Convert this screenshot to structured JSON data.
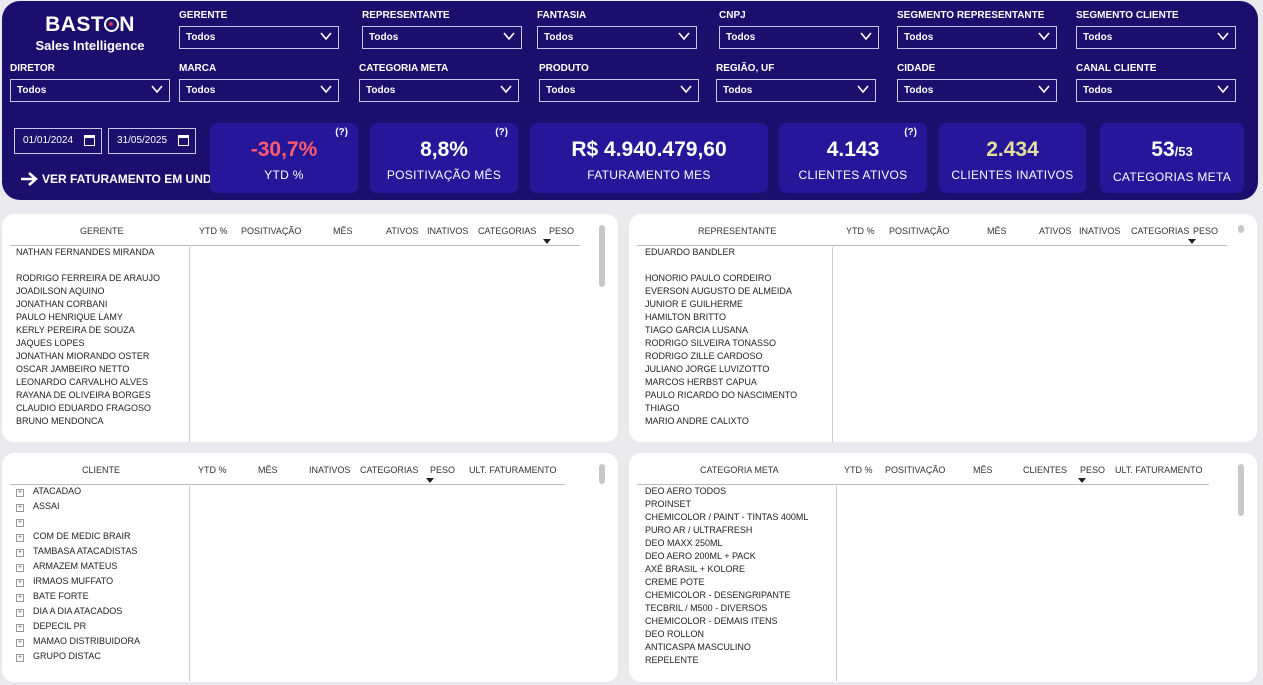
{
  "logo": {
    "brand_left": "BAST",
    "brand_right": "N",
    "subtitle": "Sales Intelligence"
  },
  "filters": [
    {
      "label": "GERENTE",
      "value": "Todos"
    },
    {
      "label": "REPRESENTANTE",
      "value": "Todos"
    },
    {
      "label": "FANTASIA",
      "value": "Todos"
    },
    {
      "label": "CNPJ",
      "value": "Todos"
    },
    {
      "label": "SEGMENTO REPRESENTANTE",
      "value": "Todos"
    },
    {
      "label": "SEGMENTO CLIENTE",
      "value": "Todos"
    },
    {
      "label": "DIRETOR",
      "value": "Todos"
    },
    {
      "label": "MARCA",
      "value": "Todos"
    },
    {
      "label": "CATEGORIA META",
      "value": "Todos"
    },
    {
      "label": "PRODUTO",
      "value": "Todos"
    },
    {
      "label": "REGIÃO, UF",
      "value": "Todos"
    },
    {
      "label": "CIDADE",
      "value": "Todos"
    },
    {
      "label": "CANAL CLIENTE",
      "value": "Todos"
    }
  ],
  "dates": {
    "start": "01/01/2024",
    "end": "31/05/2025"
  },
  "ver_link": "VER FATURAMENTO EM UND",
  "kpis": [
    {
      "value": "-30,7%",
      "label": "YTD %",
      "help": "(?)",
      "color": "#ff5a6e"
    },
    {
      "value": "8,8%",
      "label": "POSITIVAÇÃO MÊS",
      "help": "(?)",
      "color": "#ffffff"
    },
    {
      "value": "R$ 4.940.479,60",
      "label": "FATURAMENTO MES",
      "help": "",
      "color": "#ffffff"
    },
    {
      "value": "4.143",
      "label": "CLIENTES ATIVOS",
      "help": "(?)",
      "color": "#ffffff"
    },
    {
      "value": "2.434",
      "label": "CLIENTES INATIVOS",
      "help": "",
      "color": "#e6df9a"
    },
    {
      "value": "53",
      "value_suffix": "/53",
      "label": "CATEGORIAS META",
      "help": "",
      "color": "#ffffff"
    }
  ],
  "tables": {
    "gerente": {
      "headers": [
        "GERENTE",
        "YTD %",
        "POSITIVAÇÃO",
        "MÊS",
        "ATIVOS",
        "INATIVOS",
        "CATEGORIAS",
        "PESO"
      ],
      "rows": [
        "NATHAN FERNANDES MIRANDA",
        "",
        "RODRIGO FERREIRA DE ARAUJO",
        "JOADILSON AQUINO",
        "JONATHAN CORBANI",
        "PAULO HENRIQUE LAMY",
        "KERLY PEREIRA DE SOUZA",
        "JAQUES LOPES",
        "JONATHAN MIORANDO OSTER",
        "OSCAR JAMBEIRO NETTO",
        "LEONARDO CARVALHO ALVES",
        "RAYANA DE OLIVEIRA BORGES",
        "CLAUDIO EDUARDO FRAGOSO",
        "BRUNO MENDONCA"
      ]
    },
    "representante": {
      "headers": [
        "REPRESENTANTE",
        "YTD %",
        "POSITIVAÇÃO",
        "MÊS",
        "ATIVOS",
        "INATIVOS",
        "CATEGORIAS",
        "PESO"
      ],
      "rows": [
        "EDUARDO BANDLER",
        "",
        "HONORIO PAULO CORDEIRO",
        "EVERSON AUGUSTO DE ALMEIDA",
        "JUNIOR E GUILHERME",
        "HAMILTON BRITTO",
        "TIAGO GARCIA LUSANA",
        "RODRIGO SILVEIRA TONASSO",
        "RODRIGO ZILLE CARDOSO",
        "JULIANO JORGE LUVIZOTTO",
        "MARCOS HERBST CAPUA",
        "PAULO RICARDO DO NASCIMENTO",
        "THIAGO",
        "MARIO ANDRE CALIXTO"
      ]
    },
    "cliente": {
      "headers": [
        "CLIENTE",
        "YTD %",
        "MÊS",
        "INATIVOS",
        "CATEGORIAS",
        "PESO",
        "ULT. FATURAMENTO"
      ],
      "rows": [
        "ATACADAO",
        "ASSAI",
        "",
        "COM DE MEDIC BRAIR",
        "TAMBASA ATACADISTAS",
        "ARMAZEM MATEUS",
        "IRMAOS MUFFATO",
        "BATE FORTE",
        "DIA A DIA ATACADOS",
        "DEPECIL PR",
        "MAMAO DISTRIBUIDORA",
        "GRUPO DISTAC"
      ]
    },
    "categoria": {
      "headers": [
        "CATEGORIA META",
        "YTD %",
        "POSITIVAÇÃO",
        "MÊS",
        "CLIENTES",
        "PESO",
        "ULT. FATURAMENTO"
      ],
      "rows": [
        "DEO AERO TODOS",
        "PROINSET",
        "CHEMICOLOR / PAINT - TINTAS 400ML",
        "PURO AR / ULTRAFRESH",
        "DEO MAXX 250ML",
        "DEO AERO 200ML + PACK",
        "AXÉ BRASIL + KOLORE",
        "CREME POTE",
        "CHEMICOLOR - DESENGRIPANTE",
        "TECBRIL / M500 - DIVERSOS",
        "CHEMICOLOR - DEMAIS ITENS",
        "DEO ROLLON",
        "ANTICASPA MASCULINO",
        "REPELENTE"
      ]
    }
  }
}
